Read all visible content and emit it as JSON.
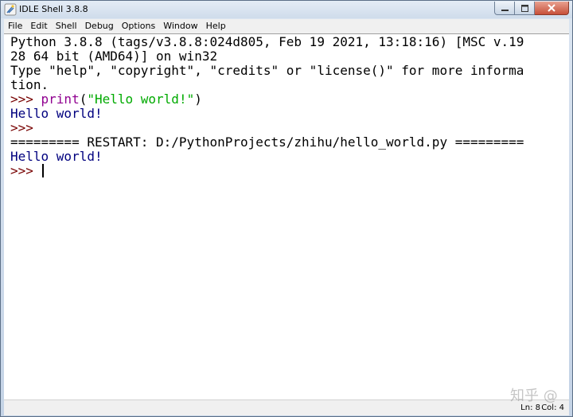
{
  "window": {
    "title": "IDLE Shell 3.8.8",
    "icon": "python-feather-icon"
  },
  "menu": [
    "File",
    "Edit",
    "Shell",
    "Debug",
    "Options",
    "Window",
    "Help"
  ],
  "shell": {
    "banner_1": "Python 3.8.8 (tags/v3.8.8:024d805, Feb 19 2021, 13:18:16) [MSC v.19",
    "banner_2": "28 64 bit (AMD64)] on win32",
    "banner_3": "Type \"help\", \"copyright\", \"credits\" or \"license()\" for more informa",
    "banner_4": "tion.",
    "prompt": ">>> ",
    "cmd_func": "print",
    "cmd_open": "(",
    "cmd_string": "\"Hello world!\"",
    "cmd_close": ")",
    "output_1": "Hello world!",
    "prompt_2": ">>>",
    "restart_line": "========= RESTART: D:/PythonProjects/zhihu/hello_world.py =========",
    "output_2": "Hello world!",
    "prompt_3": ">>> "
  },
  "status": {
    "line": "Ln: 8",
    "col": "Col: 4"
  },
  "watermark": "知乎 @",
  "colors": {
    "prompt": "#770000",
    "output": "#00007f",
    "builtin": "#900090",
    "string": "#00aa00"
  }
}
